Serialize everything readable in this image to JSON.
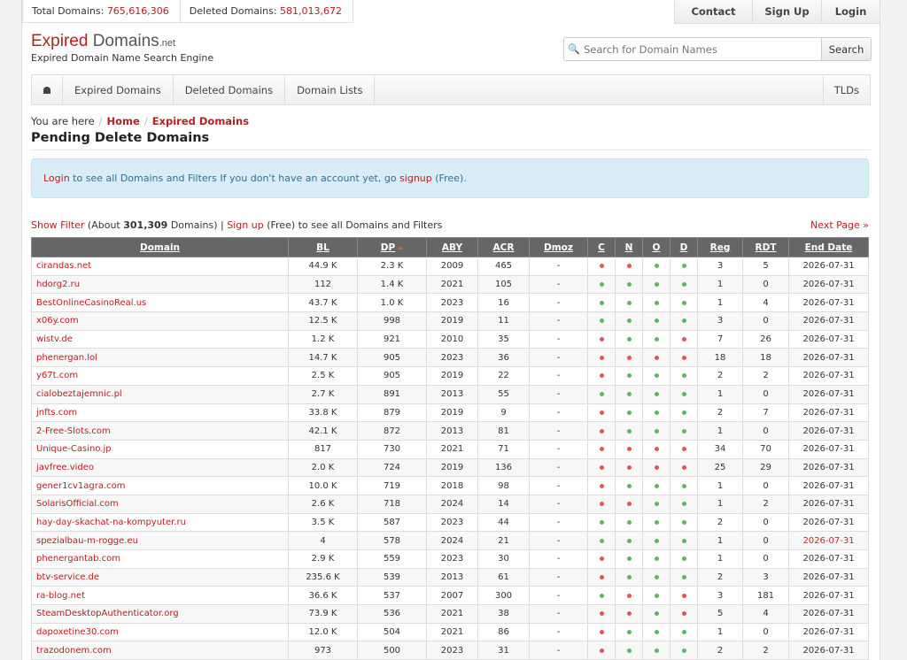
{
  "stats": {
    "total_label": "Total Domains:",
    "total_value": "765,616,306",
    "deleted_label": "Deleted Domains:",
    "deleted_value": "581,013,672"
  },
  "topnav": {
    "contact": "Contact",
    "signup": "Sign Up",
    "login": "Login"
  },
  "logo": {
    "expired": "Expired",
    "domains": "Domains",
    "net": ".net",
    "tagline": "Expired Domain Name Search Engine"
  },
  "search": {
    "placeholder": "Search for Domain Names",
    "button": "Search"
  },
  "mainnav": {
    "expired": "Expired Domains",
    "deleted": "Deleted Domains",
    "lists": "Domain Lists",
    "tlds": "TLDs"
  },
  "breadcrumb": {
    "prefix": "You are here",
    "home": "Home",
    "current": "Expired Domains"
  },
  "page_title": "Pending Delete Domains",
  "info": {
    "login": "Login",
    "middle": " to see all Domains and Filters If you don't have an account yet, go ",
    "signup": "signup",
    "suffix": " (Free)."
  },
  "filter_line": {
    "show_filter": "Show Filter",
    "about_pre": " (About ",
    "count": "301,309",
    "about_post": " Domains) | ",
    "signup": "Sign up",
    "rest": " (Free) to see all Domains and Filters",
    "next": "Next Page »"
  },
  "columns": [
    "Domain",
    "BL",
    "DP",
    "ABY",
    "ACR",
    "Dmoz",
    "C",
    "N",
    "O",
    "D",
    "Reg",
    "RDT",
    "End Date"
  ],
  "colors": {
    "green_dot": "#5cb85c",
    "red_dot": "#e25555",
    "accent": "#b52020",
    "end_date": "#2c8a1e"
  },
  "rows": [
    {
      "domain": "cirandas.net",
      "bl": "44.9 K",
      "dp": "2.3 K",
      "aby": "2009",
      "acr": "465",
      "dmoz": "-",
      "c": "r",
      "n": "r",
      "o": "g",
      "d": "g",
      "reg": "3",
      "rdt": "5",
      "end": "2026-07-31",
      "end_red": false
    },
    {
      "domain": "hdorg2.ru",
      "bl": "112",
      "dp": "1.4 K",
      "aby": "2021",
      "acr": "105",
      "dmoz": "-",
      "c": "g",
      "n": "g",
      "o": "g",
      "d": "g",
      "reg": "1",
      "rdt": "0",
      "end": "2026-07-31",
      "end_red": false
    },
    {
      "domain": "BestOnlineCasinoReal.us",
      "bl": "43.7 K",
      "dp": "1.0 K",
      "aby": "2023",
      "acr": "16",
      "dmoz": "-",
      "c": "g",
      "n": "g",
      "o": "g",
      "d": "g",
      "reg": "1",
      "rdt": "4",
      "end": "2026-07-31",
      "end_red": false
    },
    {
      "domain": "x06y.com",
      "bl": "12.5 K",
      "dp": "998",
      "aby": "2019",
      "acr": "11",
      "dmoz": "-",
      "c": "g",
      "n": "g",
      "o": "g",
      "d": "g",
      "reg": "3",
      "rdt": "0",
      "end": "2026-07-31",
      "end_red": false
    },
    {
      "domain": "wistv.de",
      "bl": "1.2 K",
      "dp": "921",
      "aby": "2010",
      "acr": "35",
      "dmoz": "-",
      "c": "r",
      "n": "g",
      "o": "g",
      "d": "r",
      "reg": "7",
      "rdt": "26",
      "end": "2026-07-31",
      "end_red": false
    },
    {
      "domain": "phenergan.lol",
      "bl": "14.7 K",
      "dp": "905",
      "aby": "2023",
      "acr": "36",
      "dmoz": "-",
      "c": "r",
      "n": "r",
      "o": "r",
      "d": "r",
      "reg": "18",
      "rdt": "18",
      "end": "2026-07-31",
      "end_red": false
    },
    {
      "domain": "y67t.com",
      "bl": "2.5 K",
      "dp": "905",
      "aby": "2019",
      "acr": "22",
      "dmoz": "-",
      "c": "r",
      "n": "g",
      "o": "g",
      "d": "g",
      "reg": "2",
      "rdt": "2",
      "end": "2026-07-31",
      "end_red": false
    },
    {
      "domain": "cialobeztajemnic.pl",
      "bl": "2.7 K",
      "dp": "891",
      "aby": "2013",
      "acr": "55",
      "dmoz": "-",
      "c": "g",
      "n": "g",
      "o": "g",
      "d": "g",
      "reg": "1",
      "rdt": "0",
      "end": "2026-07-31",
      "end_red": false
    },
    {
      "domain": "jnfts.com",
      "bl": "33.8 K",
      "dp": "879",
      "aby": "2019",
      "acr": "9",
      "dmoz": "-",
      "c": "r",
      "n": "g",
      "o": "g",
      "d": "g",
      "reg": "2",
      "rdt": "7",
      "end": "2026-07-31",
      "end_red": false
    },
    {
      "domain": "2-Free-Slots.com",
      "bl": "42.1 K",
      "dp": "872",
      "aby": "2013",
      "acr": "81",
      "dmoz": "-",
      "c": "r",
      "n": "g",
      "o": "g",
      "d": "g",
      "reg": "1",
      "rdt": "0",
      "end": "2026-07-31",
      "end_red": false
    },
    {
      "domain": "Unique-Casino.jp",
      "bl": "817",
      "dp": "730",
      "aby": "2021",
      "acr": "71",
      "dmoz": "-",
      "c": "r",
      "n": "r",
      "o": "r",
      "d": "r",
      "reg": "34",
      "rdt": "70",
      "end": "2026-07-31",
      "end_red": false
    },
    {
      "domain": "javfree.video",
      "bl": "2.0 K",
      "dp": "724",
      "aby": "2019",
      "acr": "136",
      "dmoz": "-",
      "c": "r",
      "n": "r",
      "o": "r",
      "d": "r",
      "reg": "25",
      "rdt": "29",
      "end": "2026-07-31",
      "end_red": false
    },
    {
      "domain": "gener1cv1agra.com",
      "bl": "10.0 K",
      "dp": "719",
      "aby": "2018",
      "acr": "98",
      "dmoz": "-",
      "c": "r",
      "n": "g",
      "o": "g",
      "d": "g",
      "reg": "1",
      "rdt": "0",
      "end": "2026-07-31",
      "end_red": false
    },
    {
      "domain": "SolarisOfficial.com",
      "bl": "2.6 K",
      "dp": "718",
      "aby": "2024",
      "acr": "14",
      "dmoz": "-",
      "c": "r",
      "n": "r",
      "o": "g",
      "d": "g",
      "reg": "1",
      "rdt": "2",
      "end": "2026-07-31",
      "end_red": false
    },
    {
      "domain": "hay-day-skachat-na-kompyuter.ru",
      "bl": "3.5 K",
      "dp": "587",
      "aby": "2023",
      "acr": "44",
      "dmoz": "-",
      "c": "g",
      "n": "g",
      "o": "g",
      "d": "g",
      "reg": "2",
      "rdt": "0",
      "end": "2026-07-31",
      "end_red": false
    },
    {
      "domain": "spezialbau-m-rogge.eu",
      "bl": "4",
      "dp": "578",
      "aby": "2024",
      "acr": "21",
      "dmoz": "-",
      "c": "g",
      "n": "g",
      "o": "g",
      "d": "g",
      "reg": "1",
      "rdt": "0",
      "end": "2026-07-31",
      "end_red": true
    },
    {
      "domain": "phenergantab.com",
      "bl": "2.9 K",
      "dp": "559",
      "aby": "2023",
      "acr": "30",
      "dmoz": "-",
      "c": "r",
      "n": "g",
      "o": "g",
      "d": "g",
      "reg": "1",
      "rdt": "0",
      "end": "2026-07-31",
      "end_red": false
    },
    {
      "domain": "btv-service.de",
      "bl": "235.6 K",
      "dp": "539",
      "aby": "2013",
      "acr": "61",
      "dmoz": "-",
      "c": "r",
      "n": "g",
      "o": "g",
      "d": "g",
      "reg": "2",
      "rdt": "3",
      "end": "2026-07-31",
      "end_red": false
    },
    {
      "domain": "ra-blog.net",
      "bl": "36.6 K",
      "dp": "537",
      "aby": "2007",
      "acr": "300",
      "dmoz": "-",
      "c": "g",
      "n": "r",
      "o": "g",
      "d": "r",
      "reg": "3",
      "rdt": "181",
      "end": "2026-07-31",
      "end_red": false
    },
    {
      "domain": "SteamDesktopAuthenticator.org",
      "bl": "73.9 K",
      "dp": "536",
      "aby": "2021",
      "acr": "38",
      "dmoz": "-",
      "c": "r",
      "n": "r",
      "o": "g",
      "d": "r",
      "reg": "5",
      "rdt": "4",
      "end": "2026-07-31",
      "end_red": false
    },
    {
      "domain": "dapoxetine30.com",
      "bl": "12.0 K",
      "dp": "504",
      "aby": "2021",
      "acr": "86",
      "dmoz": "-",
      "c": "r",
      "n": "g",
      "o": "g",
      "d": "g",
      "reg": "1",
      "rdt": "0",
      "end": "2026-07-31",
      "end_red": false
    },
    {
      "domain": "trazodonem.com",
      "bl": "973",
      "dp": "500",
      "aby": "2023",
      "acr": "31",
      "dmoz": "-",
      "c": "r",
      "n": "g",
      "o": "g",
      "d": "g",
      "reg": "2",
      "rdt": "2",
      "end": "2026-07-31",
      "end_red": false
    }
  ]
}
